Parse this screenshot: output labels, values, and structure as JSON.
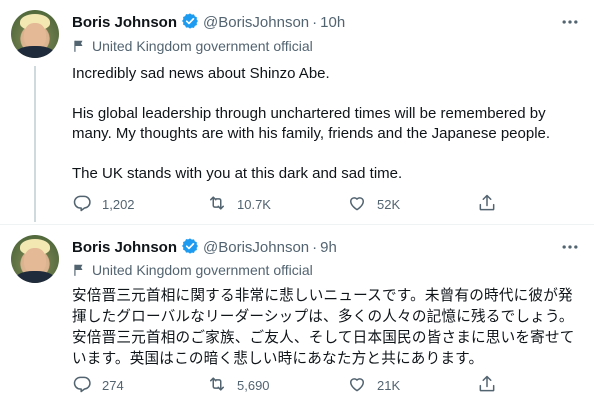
{
  "tweets": [
    {
      "author_name": "Boris Johnson",
      "handle": "@BorisJohnson",
      "separator": "·",
      "time": "10h",
      "label": "United Kingdom government official",
      "paragraphs": [
        "Incredibly sad news about Shinzo Abe.",
        "His global leadership through unchartered times will be remembered by many. My thoughts are with his family, friends and the Japanese people.",
        "The UK stands with you at this dark and sad time."
      ],
      "replies": "1,202",
      "retweets": "10.7K",
      "likes": "52K"
    },
    {
      "author_name": "Boris Johnson",
      "handle": "@BorisJohnson",
      "separator": "·",
      "time": "9h",
      "label": "United Kingdom government official",
      "text": "安倍晋三元首相に関する非常に悲しいニュースです。未曾有の時代に彼が発揮したグローバルなリーダーシップは、多くの人々の記憶に残るでしょう。安倍晋三元首相のご家族、ご友人、そして日本国民の皆さまに思いを寄せています。英国はこの暗く悲しい時にあなた方と共にあります。",
      "replies": "274",
      "retweets": "5,690",
      "likes": "21K"
    }
  ],
  "icons": {
    "verified": "verified-badge-icon",
    "label": "flag-icon",
    "more": "more-dots-icon",
    "reply": "reply-icon",
    "retweet": "retweet-icon",
    "like": "heart-icon",
    "share": "share-icon"
  },
  "colors": {
    "verified": "#1d9bf0",
    "secondary_text": "#536471",
    "thread_line": "#cfd9de"
  }
}
